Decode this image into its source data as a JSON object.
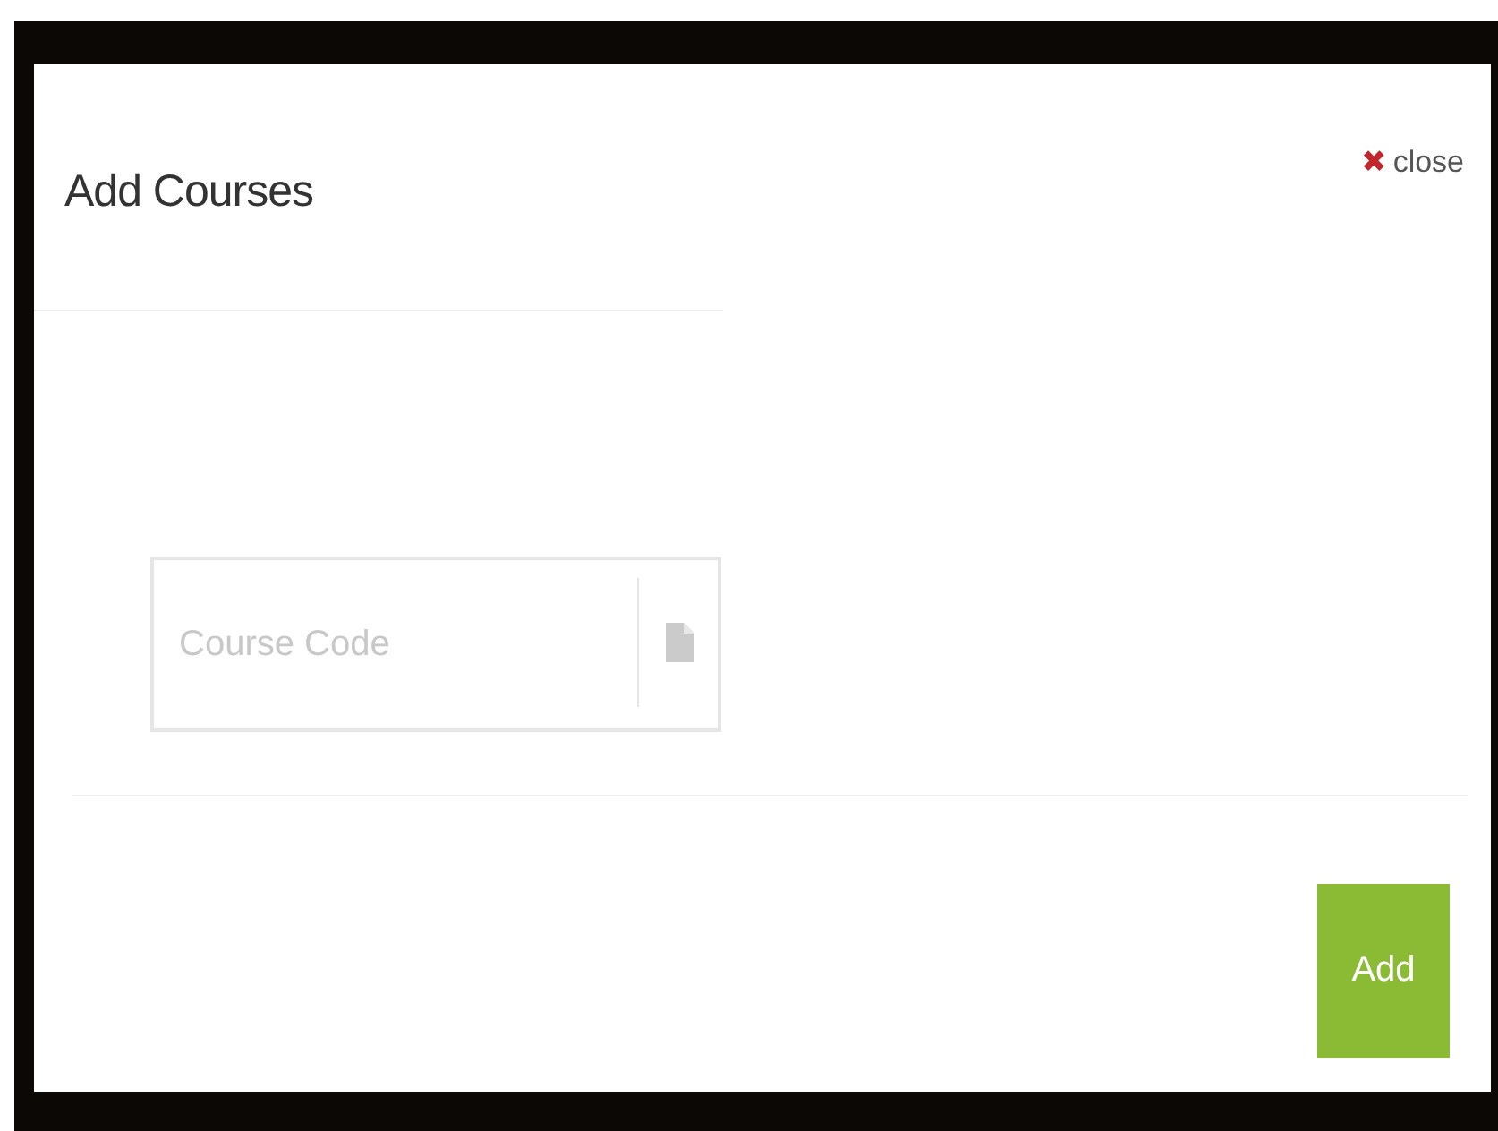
{
  "dialog": {
    "title": "Add Courses",
    "close": {
      "icon": "✖",
      "label": "close"
    }
  },
  "field": {
    "placeholder": "Course Code"
  },
  "buttons": [
    {
      "label": "Add"
    }
  ]
}
